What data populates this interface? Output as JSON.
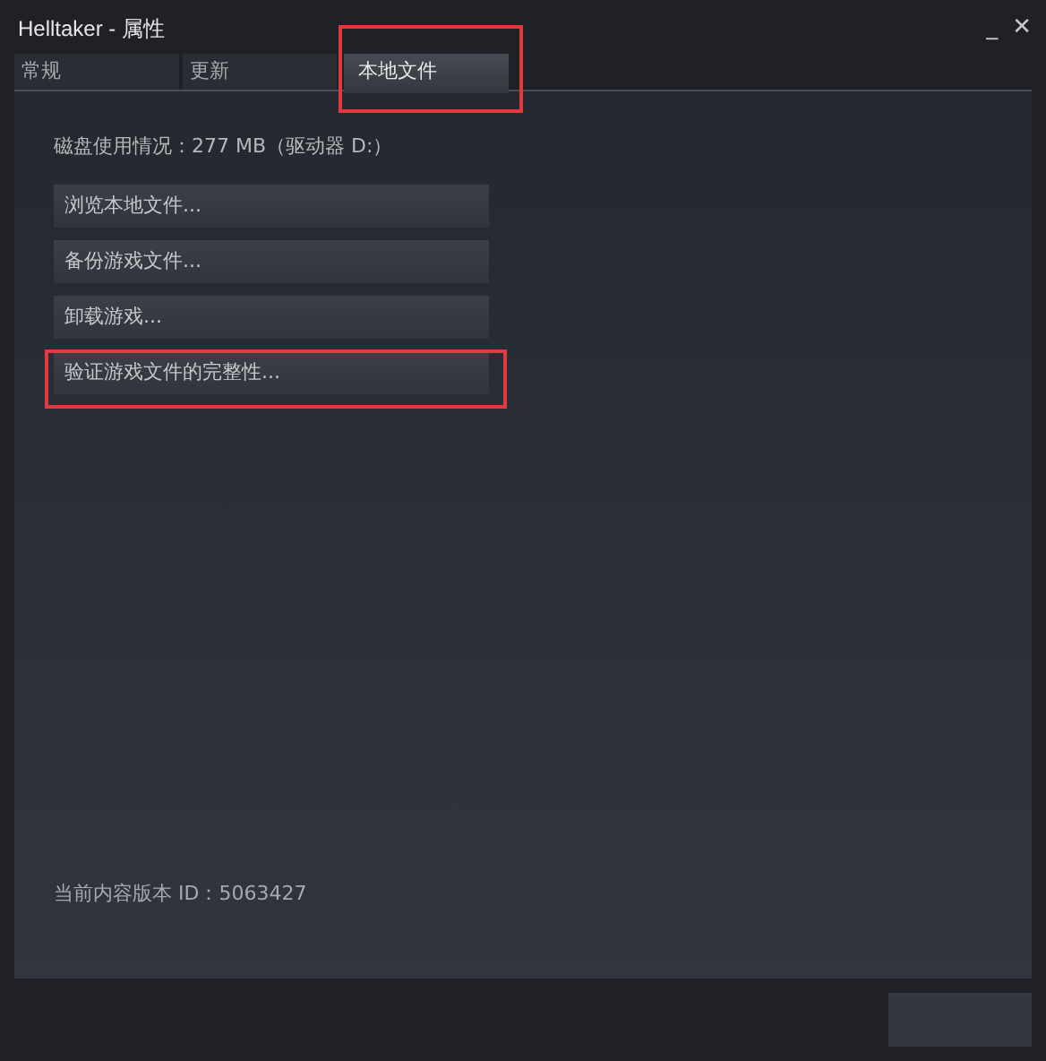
{
  "window": {
    "title": "Helltaker - 属性",
    "controls": [
      "_",
      "✕"
    ]
  },
  "tabs": [
    {
      "label": "常规",
      "selected": false,
      "highlighted": false
    },
    {
      "label": "更新",
      "selected": false,
      "highlighted": false
    },
    {
      "label": "本地文件",
      "selected": true,
      "highlighted": true
    }
  ],
  "disk_usage": "磁盘使用情况：277 MB（驱动器 D:）",
  "actions": [
    {
      "label": "浏览本地文件...",
      "highlighted": false
    },
    {
      "label": "备份游戏文件...",
      "highlighted": false
    },
    {
      "label": "卸载游戏...",
      "highlighted": false
    },
    {
      "label": "验证游戏文件的完整性...",
      "highlighted": true
    }
  ],
  "build_id": "当前内容版本 ID：5063427"
}
